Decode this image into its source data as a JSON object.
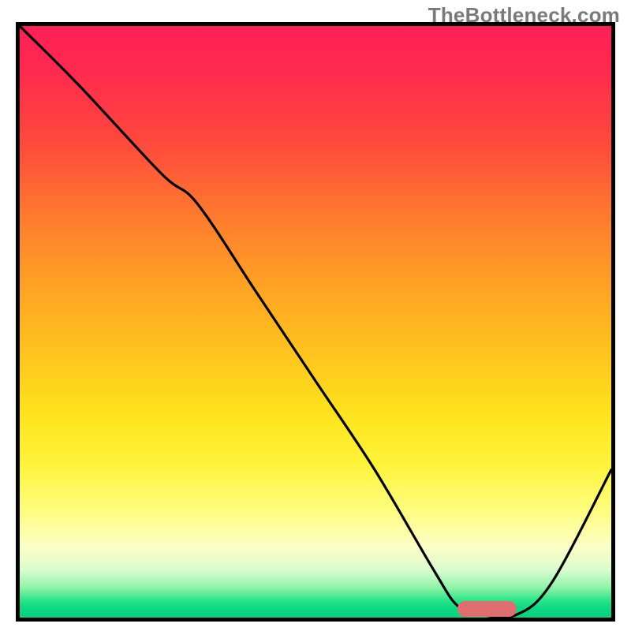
{
  "watermark": "TheBottleneck.com",
  "chart_data": {
    "type": "line",
    "title": "",
    "xlabel": "",
    "ylabel": "",
    "xlim": [
      0,
      100
    ],
    "ylim": [
      0,
      100
    ],
    "grid": false,
    "series": [
      {
        "name": "curve",
        "x": [
          0,
          10,
          24,
          30,
          40,
          50,
          60,
          70,
          74,
          78,
          84,
          90,
          100
        ],
        "y": [
          100,
          90,
          75,
          70,
          55,
          40,
          25,
          8,
          2,
          0.5,
          0.5,
          6,
          25
        ]
      }
    ],
    "annotations": {
      "min_region": {
        "x_start": 74,
        "x_end": 84,
        "y": 1.5
      }
    },
    "gradient_stops": [
      {
        "pos": 0,
        "color": "#ff1f56"
      },
      {
        "pos": 0.2,
        "color": "#ff4a3c"
      },
      {
        "pos": 0.44,
        "color": "#ffa324"
      },
      {
        "pos": 0.66,
        "color": "#ffe41e"
      },
      {
        "pos": 0.88,
        "color": "#fdfec6"
      },
      {
        "pos": 0.97,
        "color": "#2de58b"
      },
      {
        "pos": 1.0,
        "color": "#07d07f"
      }
    ]
  }
}
